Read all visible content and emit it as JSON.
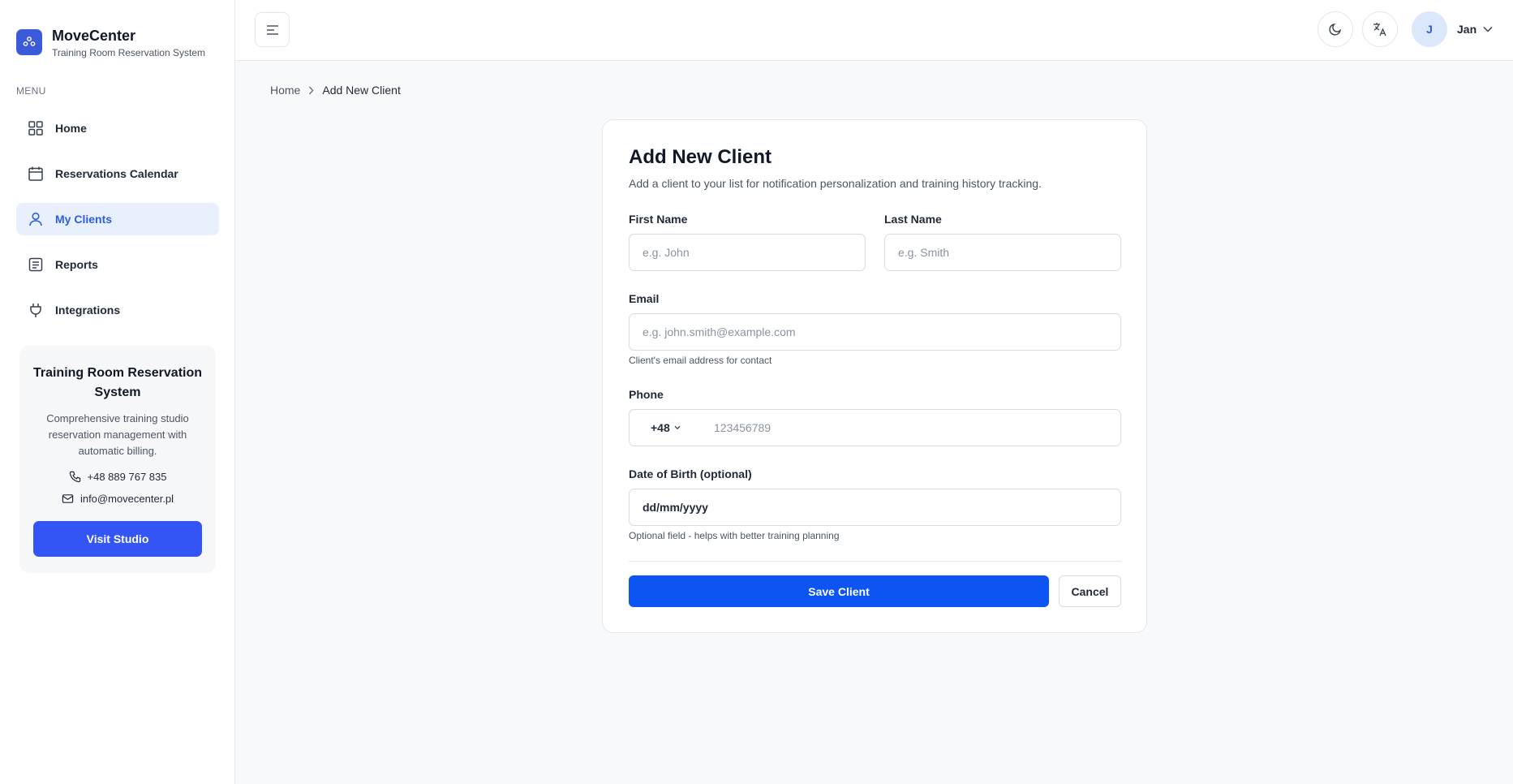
{
  "brand": {
    "name": "MoveCenter",
    "subtitle": "Training Room Reservation System",
    "icon": "people-icon"
  },
  "sidebar": {
    "menu_label": "MENU",
    "items": [
      {
        "label": "Home",
        "icon": "grid-icon",
        "active": false
      },
      {
        "label": "Reservations Calendar",
        "icon": "calendar-icon",
        "active": false
      },
      {
        "label": "My Clients",
        "icon": "user-icon",
        "active": true
      },
      {
        "label": "Reports",
        "icon": "report-icon",
        "active": false
      },
      {
        "label": "Integrations",
        "icon": "plug-icon",
        "active": false
      }
    ],
    "info_card": {
      "title": "Training Room Reservation System",
      "description": "Comprehensive training studio reservation management with automatic billing.",
      "phone": "+48 889 767 835",
      "email": "info@movecenter.pl",
      "button_label": "Visit Studio"
    }
  },
  "header": {
    "user_initial": "J",
    "user_name": "Jan"
  },
  "breadcrumb": {
    "home": "Home",
    "current": "Add New Client"
  },
  "form": {
    "title": "Add New Client",
    "subtitle": "Add a client to your list for notification personalization and training history tracking.",
    "first_name": {
      "label": "First Name",
      "placeholder": "e.g. John",
      "value": ""
    },
    "last_name": {
      "label": "Last Name",
      "placeholder": "e.g. Smith",
      "value": ""
    },
    "email": {
      "label": "Email",
      "placeholder": "e.g. john.smith@example.com",
      "value": "",
      "hint": "Client's email address for contact"
    },
    "phone": {
      "label": "Phone",
      "country_code": "+48",
      "placeholder": "123456789",
      "value": ""
    },
    "dob": {
      "label": "Date of Birth (optional)",
      "format": "dd/mm/yyyy",
      "hint": "Optional field - helps with better training planning"
    },
    "save_label": "Save Client",
    "cancel_label": "Cancel"
  },
  "colors": {
    "primary": "#0d55f2",
    "accent": "#3355f5",
    "active_bg": "#e8f0fd",
    "active_text": "#2d5ee0"
  }
}
